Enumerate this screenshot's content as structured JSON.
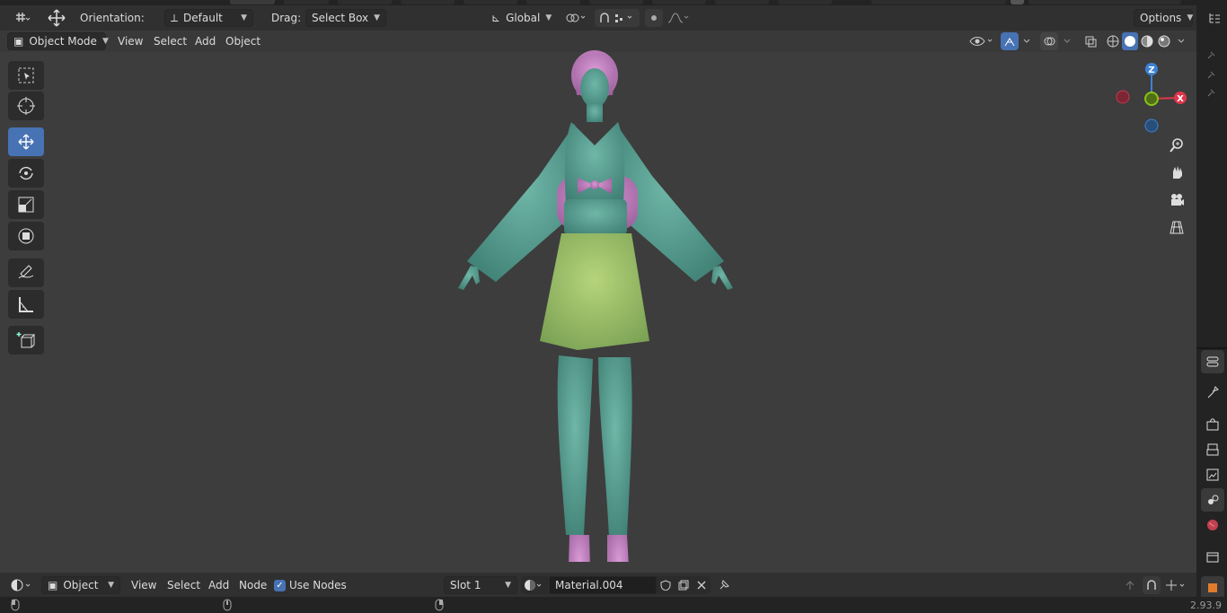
{
  "header": {
    "orientation_label": "Orientation:",
    "orientation_value": "Default",
    "drag_label": "Drag:",
    "drag_value": "Select Box",
    "transform_space": "Global",
    "options_label": "Options"
  },
  "viewport_header": {
    "mode": "Object Mode",
    "menus": [
      "View",
      "Select",
      "Add",
      "Object"
    ]
  },
  "toolbar": {
    "tools": [
      "select-box",
      "cursor",
      "move",
      "rotate",
      "scale",
      "transform",
      "annotate",
      "measure",
      "add-cube"
    ],
    "active_tool": "move"
  },
  "gizmo": {
    "x_label": "X",
    "y_label": "Y",
    "z_label": "Z",
    "colors": {
      "x": "#e0364b",
      "y": "#8bc21a",
      "z": "#3d82d6"
    }
  },
  "shader_editor": {
    "object_type": "Object",
    "menus": [
      "View",
      "Select",
      "Add",
      "Node"
    ],
    "use_nodes_label": "Use Nodes",
    "use_nodes_checked": true,
    "slot": "Slot 1",
    "material_name": "Material.004"
  },
  "status": {
    "version": "2.93.9"
  },
  "colors": {
    "accent": "#4772b3",
    "viewport_bg": "#3d3d3d",
    "model_skin": "#63a79a",
    "model_skirt": "#a9c86b",
    "model_accent": "#c27fc0"
  }
}
